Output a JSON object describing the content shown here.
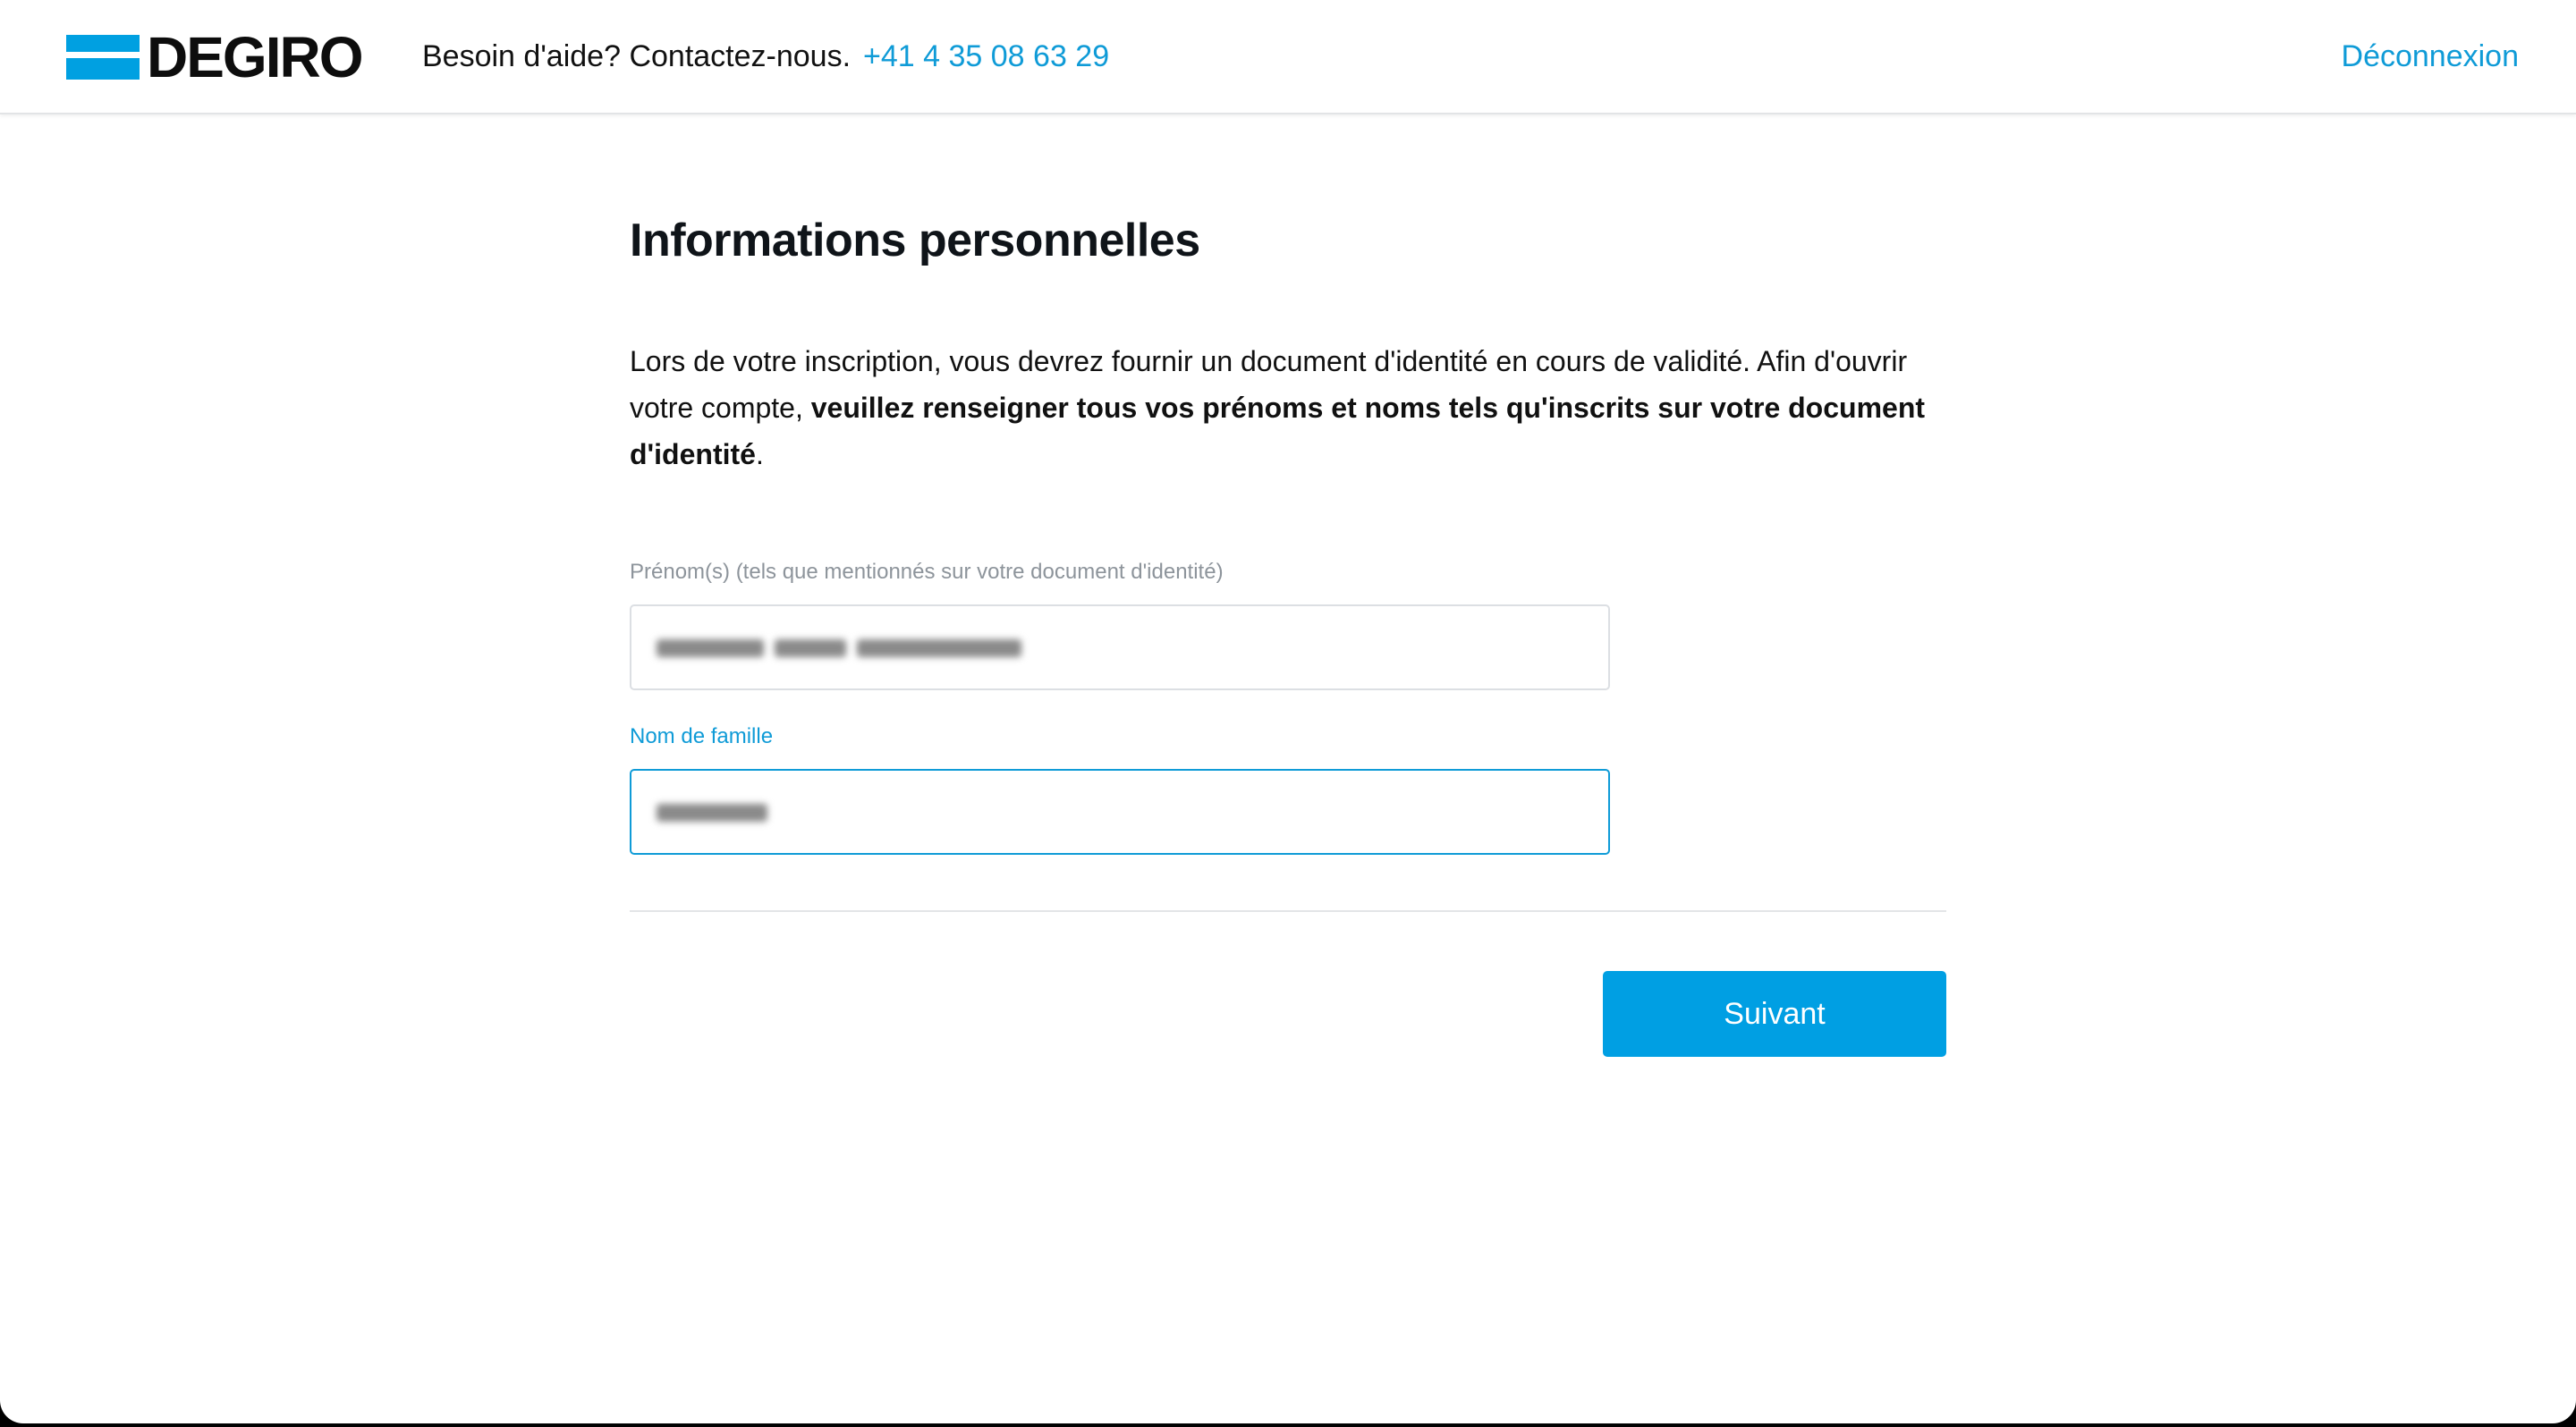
{
  "header": {
    "logo_text": "DEGIRO",
    "help_text": "Besoin d'aide? Contactez-nous.",
    "phone": "+41 4 35 08 63 29",
    "logout_label": "Déconnexion"
  },
  "main": {
    "title": "Informations personnelles",
    "intro_plain": "Lors de votre inscription, vous devrez fournir un document d'identité en cours de validité. Afin d'ouvrir votre compte, ",
    "intro_bold": "veuillez renseigner tous vos prénoms et noms tels qu'inscrits sur votre document d'identité",
    "intro_end": "."
  },
  "form": {
    "first_name_label": "Prénom(s) (tels que mentionnés sur votre document d'identité)",
    "last_name_label": "Nom de famille",
    "first_name_value_state": "blurred",
    "last_name_value_state": "blurred",
    "next_label": "Suivant"
  },
  "colors": {
    "brand_blue": "#00a0e1",
    "link_blue": "#0f9bd7",
    "button_blue": "#009fe3"
  },
  "icons": {
    "logo_mark": "degiro-logo-icon"
  }
}
